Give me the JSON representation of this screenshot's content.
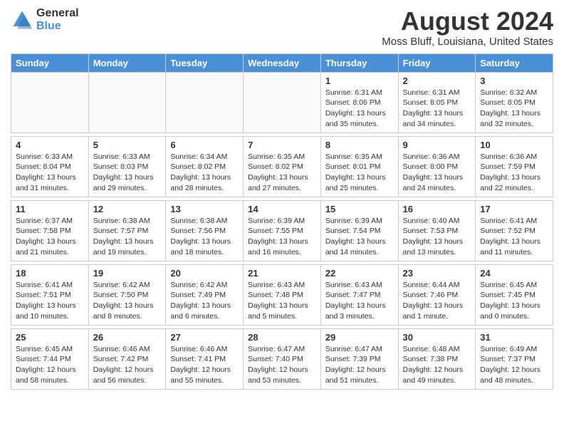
{
  "header": {
    "logo_general": "General",
    "logo_blue": "Blue",
    "month_title": "August 2024",
    "location": "Moss Bluff, Louisiana, United States"
  },
  "days_of_week": [
    "Sunday",
    "Monday",
    "Tuesday",
    "Wednesday",
    "Thursday",
    "Friday",
    "Saturday"
  ],
  "weeks": [
    [
      {
        "day": "",
        "info": ""
      },
      {
        "day": "",
        "info": ""
      },
      {
        "day": "",
        "info": ""
      },
      {
        "day": "",
        "info": ""
      },
      {
        "day": "1",
        "info": "Sunrise: 6:31 AM\nSunset: 8:06 PM\nDaylight: 13 hours\nand 35 minutes."
      },
      {
        "day": "2",
        "info": "Sunrise: 6:31 AM\nSunset: 8:05 PM\nDaylight: 13 hours\nand 34 minutes."
      },
      {
        "day": "3",
        "info": "Sunrise: 6:32 AM\nSunset: 8:05 PM\nDaylight: 13 hours\nand 32 minutes."
      }
    ],
    [
      {
        "day": "4",
        "info": "Sunrise: 6:33 AM\nSunset: 8:04 PM\nDaylight: 13 hours\nand 31 minutes."
      },
      {
        "day": "5",
        "info": "Sunrise: 6:33 AM\nSunset: 8:03 PM\nDaylight: 13 hours\nand 29 minutes."
      },
      {
        "day": "6",
        "info": "Sunrise: 6:34 AM\nSunset: 8:02 PM\nDaylight: 13 hours\nand 28 minutes."
      },
      {
        "day": "7",
        "info": "Sunrise: 6:35 AM\nSunset: 8:02 PM\nDaylight: 13 hours\nand 27 minutes."
      },
      {
        "day": "8",
        "info": "Sunrise: 6:35 AM\nSunset: 8:01 PM\nDaylight: 13 hours\nand 25 minutes."
      },
      {
        "day": "9",
        "info": "Sunrise: 6:36 AM\nSunset: 8:00 PM\nDaylight: 13 hours\nand 24 minutes."
      },
      {
        "day": "10",
        "info": "Sunrise: 6:36 AM\nSunset: 7:59 PM\nDaylight: 13 hours\nand 22 minutes."
      }
    ],
    [
      {
        "day": "11",
        "info": "Sunrise: 6:37 AM\nSunset: 7:58 PM\nDaylight: 13 hours\nand 21 minutes."
      },
      {
        "day": "12",
        "info": "Sunrise: 6:38 AM\nSunset: 7:57 PM\nDaylight: 13 hours\nand 19 minutes."
      },
      {
        "day": "13",
        "info": "Sunrise: 6:38 AM\nSunset: 7:56 PM\nDaylight: 13 hours\nand 18 minutes."
      },
      {
        "day": "14",
        "info": "Sunrise: 6:39 AM\nSunset: 7:55 PM\nDaylight: 13 hours\nand 16 minutes."
      },
      {
        "day": "15",
        "info": "Sunrise: 6:39 AM\nSunset: 7:54 PM\nDaylight: 13 hours\nand 14 minutes."
      },
      {
        "day": "16",
        "info": "Sunrise: 6:40 AM\nSunset: 7:53 PM\nDaylight: 13 hours\nand 13 minutes."
      },
      {
        "day": "17",
        "info": "Sunrise: 6:41 AM\nSunset: 7:52 PM\nDaylight: 13 hours\nand 11 minutes."
      }
    ],
    [
      {
        "day": "18",
        "info": "Sunrise: 6:41 AM\nSunset: 7:51 PM\nDaylight: 13 hours\nand 10 minutes."
      },
      {
        "day": "19",
        "info": "Sunrise: 6:42 AM\nSunset: 7:50 PM\nDaylight: 13 hours\nand 8 minutes."
      },
      {
        "day": "20",
        "info": "Sunrise: 6:42 AM\nSunset: 7:49 PM\nDaylight: 13 hours\nand 6 minutes."
      },
      {
        "day": "21",
        "info": "Sunrise: 6:43 AM\nSunset: 7:48 PM\nDaylight: 13 hours\nand 5 minutes."
      },
      {
        "day": "22",
        "info": "Sunrise: 6:43 AM\nSunset: 7:47 PM\nDaylight: 13 hours\nand 3 minutes."
      },
      {
        "day": "23",
        "info": "Sunrise: 6:44 AM\nSunset: 7:46 PM\nDaylight: 13 hours\nand 1 minute."
      },
      {
        "day": "24",
        "info": "Sunrise: 6:45 AM\nSunset: 7:45 PM\nDaylight: 13 hours\nand 0 minutes."
      }
    ],
    [
      {
        "day": "25",
        "info": "Sunrise: 6:45 AM\nSunset: 7:44 PM\nDaylight: 12 hours\nand 58 minutes."
      },
      {
        "day": "26",
        "info": "Sunrise: 6:46 AM\nSunset: 7:42 PM\nDaylight: 12 hours\nand 56 minutes."
      },
      {
        "day": "27",
        "info": "Sunrise: 6:46 AM\nSunset: 7:41 PM\nDaylight: 12 hours\nand 55 minutes."
      },
      {
        "day": "28",
        "info": "Sunrise: 6:47 AM\nSunset: 7:40 PM\nDaylight: 12 hours\nand 53 minutes."
      },
      {
        "day": "29",
        "info": "Sunrise: 6:47 AM\nSunset: 7:39 PM\nDaylight: 12 hours\nand 51 minutes."
      },
      {
        "day": "30",
        "info": "Sunrise: 6:48 AM\nSunset: 7:38 PM\nDaylight: 12 hours\nand 49 minutes."
      },
      {
        "day": "31",
        "info": "Sunrise: 6:49 AM\nSunset: 7:37 PM\nDaylight: 12 hours\nand 48 minutes."
      }
    ]
  ]
}
